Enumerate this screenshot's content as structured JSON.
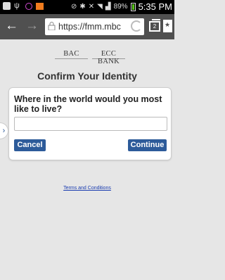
{
  "status_bar": {
    "battery": "89%",
    "time": "5:35 PM",
    "icons": [
      "notification-icon",
      "usb-icon",
      "app-circle-icon",
      "orange-app-icon",
      "mute-icon",
      "bluetooth-icon",
      "no-sim-icon",
      "wifi-icon",
      "signal-icon",
      "battery-icon"
    ]
  },
  "browser": {
    "url": "https://fmm.mbc",
    "tab_count": "2"
  },
  "page": {
    "logos": [
      "BAC",
      "ECC BANK"
    ],
    "title": "Confirm Your Identity",
    "question": "Where in the world would you most like to live?",
    "answer_value": "",
    "cancel_label": "Cancel",
    "continue_label": "Continue",
    "terms_label": "Terms and Conditions"
  },
  "colors": {
    "button_blue": "#2d5b9a",
    "browser_bar": "#505050",
    "link": "#1a3cb0"
  }
}
